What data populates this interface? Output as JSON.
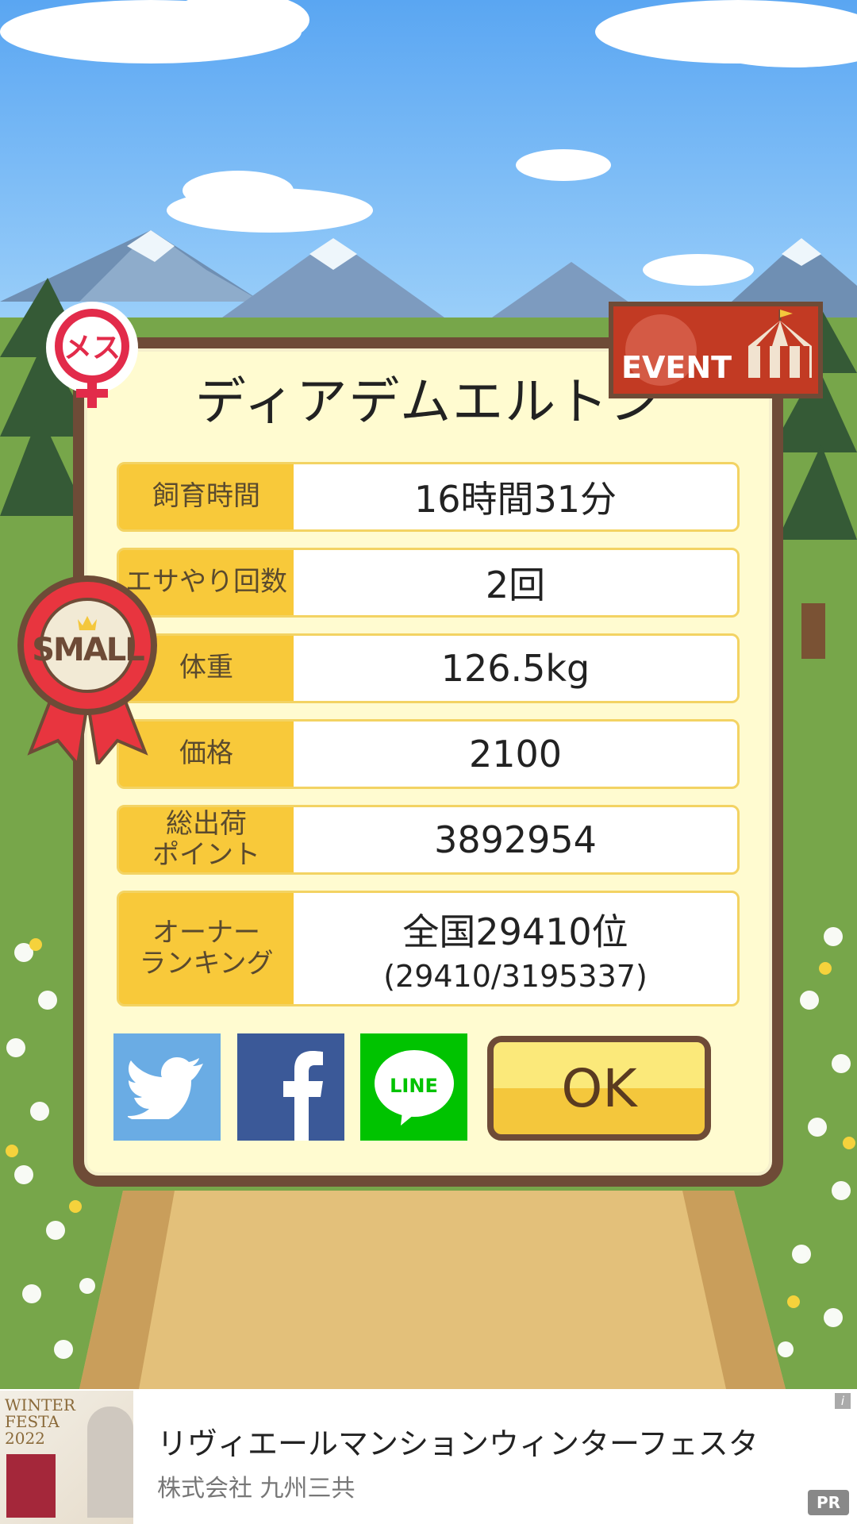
{
  "header": {
    "gender_badge": "メス",
    "event_badge": "EVENT",
    "size_ribbon": "SMALL"
  },
  "pig_name": "ディアデムエルトン",
  "stats": [
    {
      "label": "飼育時間",
      "value": "16時間31分"
    },
    {
      "label": "エサやり回数",
      "value": "2回"
    },
    {
      "label": "体重",
      "value": "126.5kg"
    },
    {
      "label": "価格",
      "value": "2100"
    },
    {
      "label": "総出荷\nポイント",
      "value": "3892954"
    },
    {
      "label": "オーナー\nランキング",
      "value": "全国29410位",
      "sub": "(29410/3195337)"
    }
  ],
  "share": {
    "twitter_icon": "twitter-bird-icon",
    "facebook_icon": "facebook-f-icon",
    "line_label": "LINE"
  },
  "ok_label": "OK",
  "ad": {
    "title": "リヴィエールマンションウィンターフェスタ",
    "advertiser": "株式会社 九州三共",
    "pr_badge": "PR",
    "info": "i",
    "thumb_title": "WINTER FESTA 2022"
  },
  "colors": {
    "sky": "#6fb4f5",
    "dialog_border": "#6e4b37",
    "dialog_fill": "#fffbd0",
    "label_fill": "#f8c93a",
    "twitter": "#6aace4",
    "facebook": "#3b5998",
    "line": "#00c300"
  }
}
